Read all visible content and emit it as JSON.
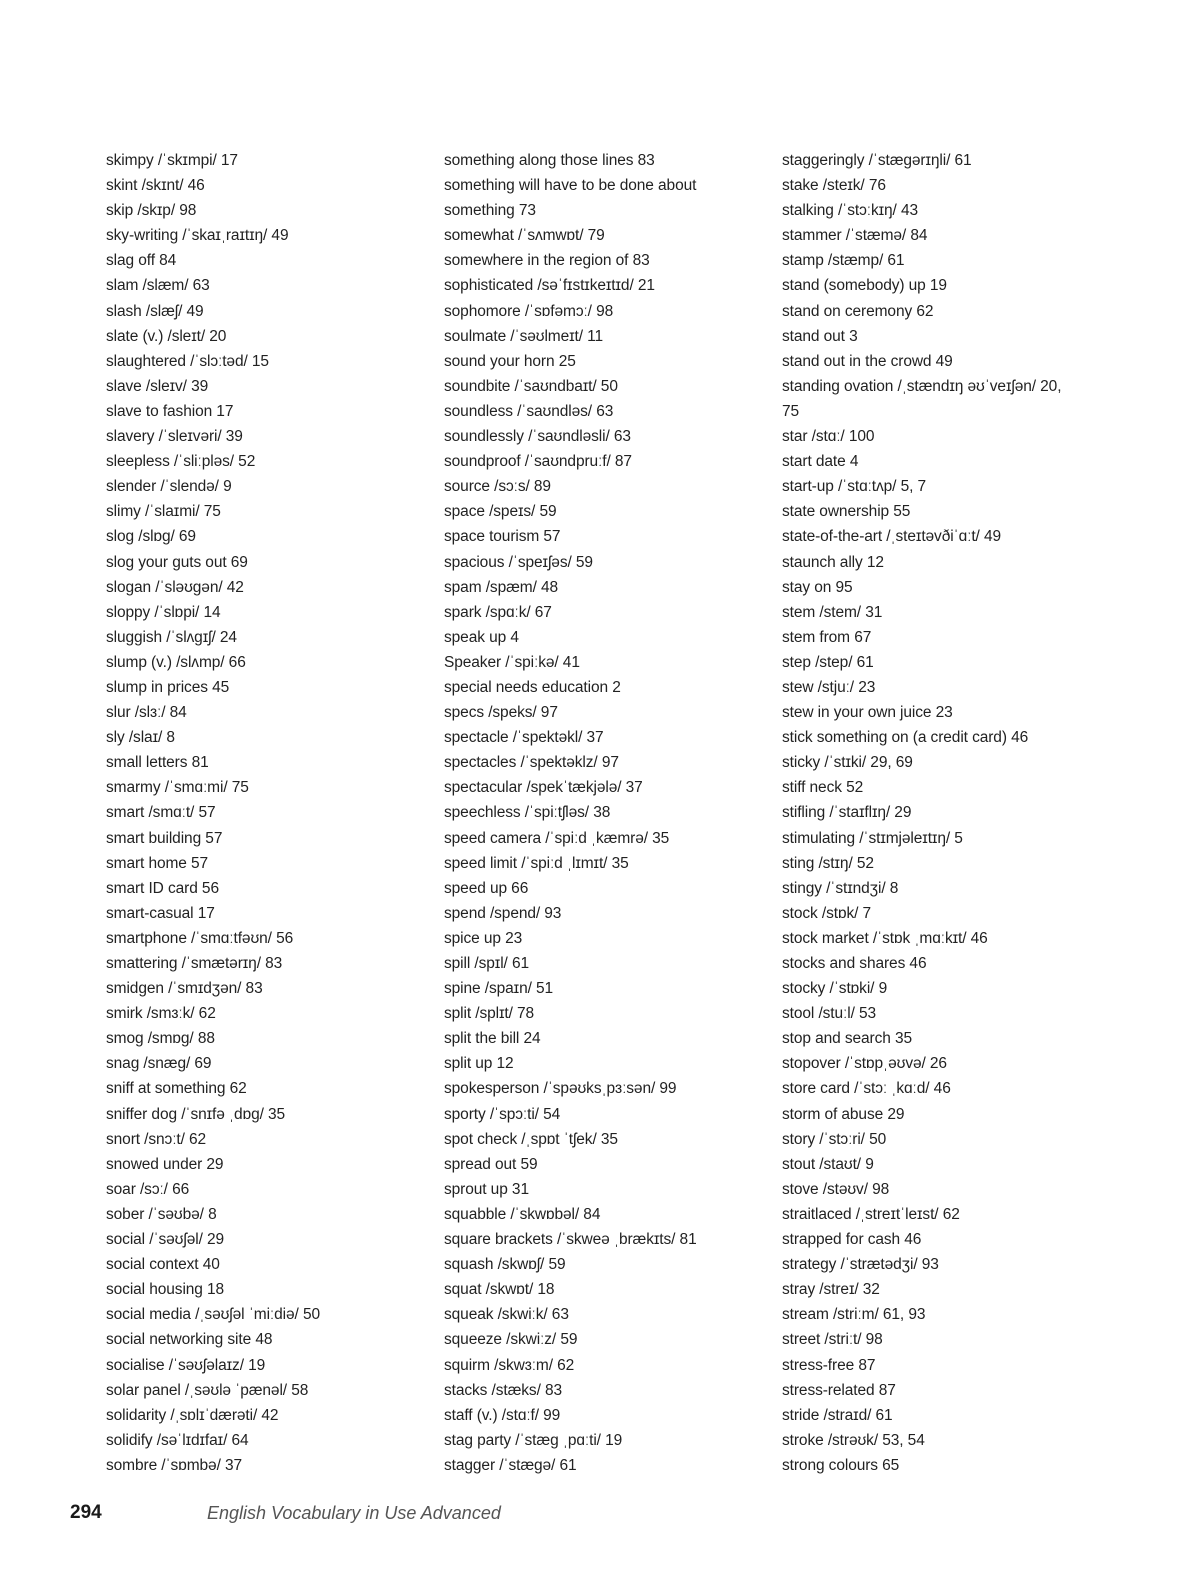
{
  "columns": [
    [
      "skimpy  /ˈskɪmpi/  17",
      "skint  /skɪnt/  46",
      "skip  /skɪp/  98",
      "sky-writing  /ˈskaɪˌraɪtɪŋ/  49",
      "slag off  84",
      "slam  /slæm/  63",
      "slash  /slæʃ/  49",
      "slate (v.)  /sleɪt/  20",
      "slaughtered  /ˈslɔːtəd/  15",
      "slave  /sleɪv/  39",
      "slave to fashion  17",
      "slavery  /ˈsleɪvəri/  39",
      "sleepless  /ˈsliːpləs/  52",
      "slender  /ˈslendə/  9",
      "slimy  /ˈslaɪmi/  75",
      "slog  /slɒg/  69",
      "slog your guts out  69",
      "slogan  /ˈsləʊgən/  42",
      "sloppy  /ˈslɒpi/  14",
      "sluggish  /ˈslʌgɪʃ/  24",
      "slump (v.)  /slʌmp/  66",
      "slump in prices  45",
      "slur  /slɜː/  84",
      "sly  /slaɪ/  8",
      "small letters  81",
      "smarmy  /ˈsmɑːmi/  75",
      "smart  /smɑːt/  57",
      "smart building  57",
      "smart home  57",
      "smart ID card  56",
      "smart-casual  17",
      "smartphone  /ˈsmɑːtfəʊn/  56",
      "smattering  /ˈsmætərɪŋ/  83",
      "smidgen  /ˈsmɪdʒən/  83",
      "smirk  /smɜːk/  62",
      "smog  /smɒg/  88",
      "snag  /snæg/  69",
      "sniff at something  62",
      "sniffer dog  /ˈsnɪfə ˌdɒg/  35",
      "snort  /snɔːt/  62",
      "snowed under  29",
      "soar  /sɔː/  66",
      "sober  /ˈsəʊbə/  8",
      "social  /ˈsəʊʃəl/  29",
      "social context  40",
      "social housing  18",
      "social media  /ˌsəʊʃəl ˈmiːdiə/  50",
      "social networking site  48",
      "socialise  /ˈsəʊʃəlaɪz/  19",
      "solar panel  /ˌsəʊlə ˈpænəl/  58",
      "solidarity  /ˌsɒlɪˈdærəti/  42",
      "solidify  /səˈlɪdɪfaɪ/  64",
      "sombre  /ˈsɒmbə/  37"
    ],
    [
      "something along those lines  83",
      "something will have to be done about",
      "something  73",
      "somewhat  /ˈsʌmwɒt/  79",
      "somewhere in the region of  83",
      "sophisticated  /səˈfɪstɪkeɪtɪd/  21",
      "sophomore  /ˈsɒfəmɔː/  98",
      "soulmate  /ˈsəʊlmeɪt/  11",
      "sound your horn  25",
      "soundbite  /ˈsaʊndbaɪt/  50",
      "soundless  /ˈsaʊndləs/  63",
      "soundlessly  /ˈsaʊndləsli/  63",
      "soundproof  /ˈsaʊndpruːf/  87",
      "source  /sɔːs/  89",
      "space  /speɪs/  59",
      "space tourism  57",
      "spacious  /ˈspeɪʃəs/  59",
      "spam  /spæm/  48",
      "spark  /spɑːk/  67",
      "speak up  4",
      "Speaker  /ˈspiːkə/  41",
      "special needs education  2",
      "specs  /speks/  97",
      "spectacle  /ˈspektəkl/  37",
      "spectacles  /ˈspektəklz/  97",
      "spectacular  /spekˈtækjələ/  37",
      "speechless  /ˈspiːtʃləs/  38",
      "speed camera  /ˈspiːd ˌkæmrə/  35",
      "speed limit  /ˈspiːd ˌlɪmɪt/  35",
      "speed up  66",
      "spend  /spend/  93",
      "spice up  23",
      "spill  /spɪl/  61",
      "spine  /spaɪn/  51",
      "split  /splɪt/  78",
      "split the bill  24",
      "split up  12",
      "spokesperson  /ˈspəʊksˌpɜːsən/  99",
      "sporty  /ˈspɔːti/  54",
      "spot check  /ˌspɒt ˈtʃek/  35",
      "spread out  59",
      "sprout up  31",
      "squabble  /ˈskwɒbəl/  84",
      "square brackets  /ˈskweə ˌbrækɪts/  81",
      "squash  /skwɒʃ/  59",
      "squat  /skwɒt/  18",
      "squeak  /skwiːk/  63",
      "squeeze  /skwiːz/  59",
      "squirm  /skwɜːm/  62",
      "stacks  /stæks/  83",
      "staff (v.)  /stɑːf/  99",
      "stag party  /ˈstæg ˌpɑːti/  19",
      "stagger  /ˈstægə/  61"
    ],
    [
      "staggeringly  /ˈstægərɪŋli/  61",
      "stake  /steɪk/  76",
      "stalking  /ˈstɔːkɪŋ/  43",
      "stammer  /ˈstæmə/  84",
      "stamp  /stæmp/  61",
      "stand (somebody) up  19",
      "stand on ceremony  62",
      "stand out  3",
      "stand out in the crowd  49",
      "standing ovation  /ˌstændɪŋ əʊˈveɪʃən/  20,",
      "75",
      "star  /stɑː/  100",
      "start date  4",
      "start-up  /ˈstɑːtʌp/  5,  7",
      "state ownership  55",
      "state-of-the-art  /ˌsteɪtəvðiˈɑːt/  49",
      "staunch ally  12",
      "stay on  95",
      "stem  /stem/  31",
      "stem from  67",
      "step  /step/  61",
      "stew  /stjuː/  23",
      "stew in your own juice  23",
      "stick something on (a credit card)  46",
      "sticky  /ˈstɪki/  29, 69",
      "stiff neck  52",
      "stifling  /ˈstaɪflɪŋ/  29",
      "stimulating  /ˈstɪmjəleɪtɪŋ/  5",
      "sting  /stɪŋ/  52",
      "stingy  /ˈstɪndʒi/  8",
      "stock  /stɒk/  7",
      "stock market  /ˈstɒk ˌmɑːkɪt/  46",
      "stocks and shares  46",
      "stocky  /ˈstɒki/  9",
      "stool  /stuːl/  53",
      "stop and search  35",
      "stopover  /ˈstɒpˌəʊvə/  26",
      "store card  /ˈstɔː ˌkɑːd/  46",
      "storm of abuse  29",
      "story  /ˈstɔːri/  50",
      "stout  /staʊt/  9",
      "stove  /stəʊv/  98",
      "straitlaced  /ˌstreɪtˈleɪst/  62",
      "strapped for cash  46",
      "strategy  /ˈstrætədʒi/  93",
      "stray  /streɪ/  32",
      "stream  /striːm/  61, 93",
      "street  /striːt/  98",
      "stress-free  87",
      "stress-related  87",
      "stride  /straɪd/  61",
      "stroke  /strəʊk/  53, 54",
      "strong colours  65"
    ]
  ],
  "footer": {
    "page_number": "294",
    "book_title": "English Vocabulary in Use Advanced"
  }
}
